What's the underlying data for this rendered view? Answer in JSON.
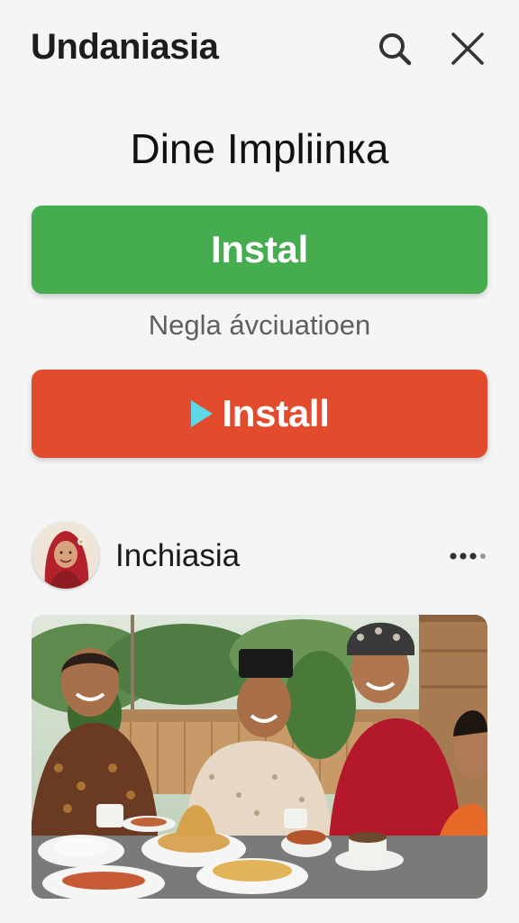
{
  "app": {
    "brand": "Undaniasia"
  },
  "header": {
    "search_icon": "search-icon",
    "close_icon": "close-icon"
  },
  "promo": {
    "title": "Dine Impliinка",
    "primary_button_label": "Instal",
    "subtitle": "Negla ávciuatioen",
    "secondary_button_label": "Install",
    "secondary_button_icon": "play-icon",
    "colors": {
      "primary_button": "#45ad4f",
      "secondary_button": "#e24b2b",
      "play_icon": "#5ed6e6"
    }
  },
  "post": {
    "author": "Inchiasia",
    "avatar_icon": "avatar",
    "more_icon": "more-options-icon"
  }
}
